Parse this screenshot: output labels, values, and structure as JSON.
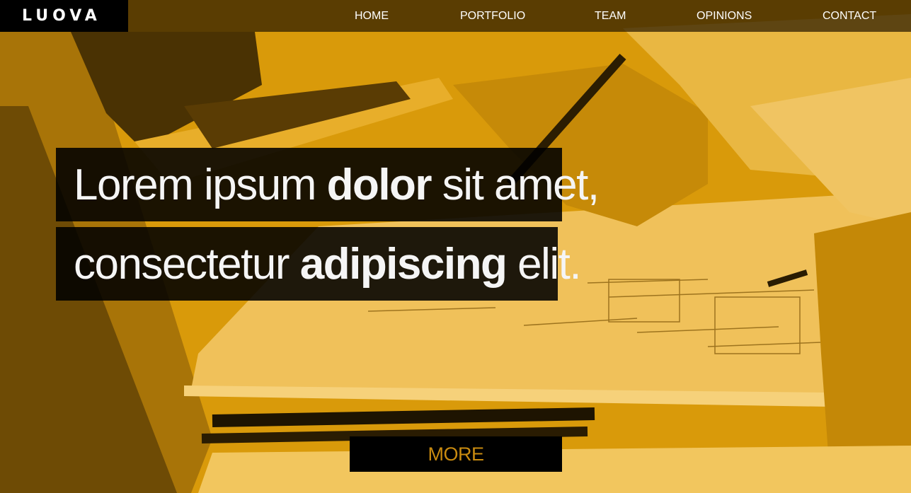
{
  "brand": {
    "logo_text": "LUOVA"
  },
  "nav": {
    "items": [
      {
        "label": "HOME"
      },
      {
        "label": "PORTFOLIO"
      },
      {
        "label": "TEAM"
      },
      {
        "label": "OPINIONS"
      },
      {
        "label": "CONTACT"
      }
    ]
  },
  "hero": {
    "line1": {
      "before": "Lorem ipsum ",
      "bold": "dolor",
      "after": " sit amet,"
    },
    "line2": {
      "before": "consectetur ",
      "bold": "adipiscing",
      "after": " elit."
    },
    "more_label": "MORE"
  },
  "colors": {
    "accent": "#d99a0a",
    "dark": "#000000",
    "button_text": "#c98b10"
  }
}
